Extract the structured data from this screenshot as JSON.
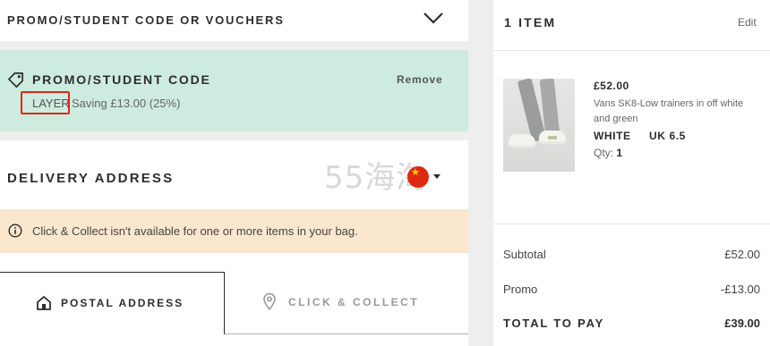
{
  "promo_section": {
    "header_title": "PROMO/STUDENT CODE OR VOUCHERS",
    "applied_title": "PROMO/STUDENT CODE",
    "remove_label": "Remove",
    "code": "LAYER",
    "saving_text": "Saving £13.00 (25%)",
    "bg_color": "#cdebdf"
  },
  "delivery": {
    "title": "DELIVERY ADDRESS",
    "watermark": "55海淘",
    "country_flag": "china-flag-icon",
    "notice": "Click & Collect isn't available for one or more items in your bag.",
    "notice_bg": "#fbe7cd",
    "tabs": [
      {
        "label": "POSTAL ADDRESS",
        "icon": "home-icon",
        "active": true
      },
      {
        "label": "CLICK & COLLECT",
        "icon": "location-pin-icon",
        "active": false
      }
    ]
  },
  "bag": {
    "items_title": "1 ITEM",
    "edit_label": "Edit",
    "product": {
      "price": "£52.00",
      "name": "Vans SK8-Low trainers in off white and green",
      "color": "WHITE",
      "size": "UK 6.5",
      "qty_label": "Qty:",
      "qty": "1"
    },
    "summary": {
      "subtotal_label": "Subtotal",
      "subtotal": "£52.00",
      "promo_label": "Promo",
      "promo": "-£13.00",
      "total_label": "TOTAL TO PAY",
      "total": "£39.00"
    }
  }
}
